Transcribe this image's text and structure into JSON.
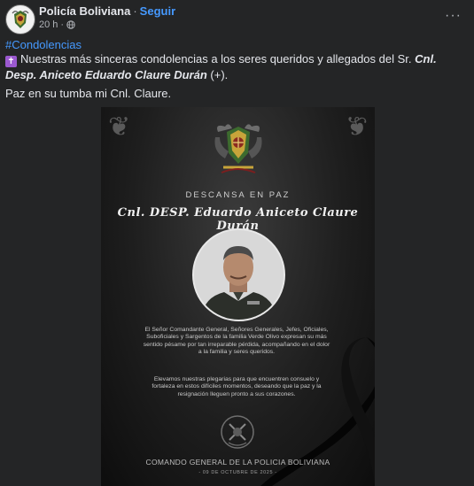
{
  "header": {
    "page_name": "Policía Boliviana",
    "separator": "·",
    "follow_label": "Seguir",
    "timestamp": "20 h",
    "dot": "·",
    "privacy_icon": "globe-icon",
    "more_icon": "more-options-icon",
    "more_glyph": "···"
  },
  "post": {
    "hashtag": "#Condolencias",
    "message_prefix": "Nuestras más sinceras condolencias a los seres queridos y allegados del Sr. ",
    "message_name": "Cnl. Desp. Aniceto Eduardo Claure Durán",
    "message_suffix": " (+).",
    "cross_glyph": "✝",
    "closing": "Paz en su tumba mi Cnl. Claure."
  },
  "image": {
    "rip_heading": "DESCANSA EN PAZ",
    "deceased_name": "Cnl. DESP. Eduardo Aniceto Claure Durán",
    "paragraph_1": "El Señor Comandante General, Señores Generales, Jefes, Oficiales, Suboficiales y Sargentos de la familia Verde Olivo expresan su más sentido pésame por tan irreparable pérdida, acompañando en el dolor a la familia y seres queridos.",
    "paragraph_2": "Elevamos nuestras plegarias para que encuentren consuelo y fortaleza en estos difíciles momentos, deseando que la paz y la resignación lleguen pronto a sus corazones.",
    "command_name": "COMANDO GENERAL DE LA POLICIA BOLIVIANA",
    "date": "- 09 DE OCTUBRE DE 2025 -"
  },
  "colors": {
    "background": "#242526",
    "link": "#4599ff",
    "text": "#e4e6eb",
    "muted": "#b0b3b8",
    "police_green": "#3d6b2e"
  }
}
